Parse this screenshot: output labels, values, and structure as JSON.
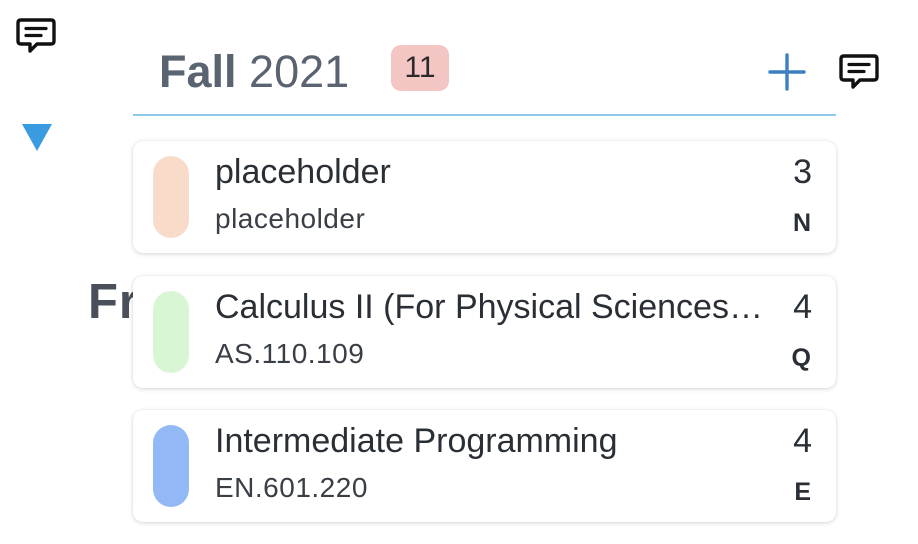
{
  "icons": {
    "left_comment": "comment-icon",
    "collapse": "triangle-down-icon",
    "add": "plus-icon",
    "header_comment": "comment-icon"
  },
  "background_heading": "Fr",
  "semester": {
    "season": "Fall",
    "year": "2021",
    "credit_total": "11"
  },
  "courses": [
    {
      "name": "placeholder",
      "code": "placeholder",
      "credits": "3",
      "area": "N",
      "color": "#f8dcc9"
    },
    {
      "name": "Calculus II (For Physical Sciences and Engineering)",
      "code": "AS.110.109",
      "credits": "4",
      "area": "Q",
      "color": "#d8f6d3"
    },
    {
      "name": "Intermediate Programming",
      "code": "EN.601.220",
      "credits": "4",
      "area": "E",
      "color": "#92b8f6"
    }
  ],
  "colors": {
    "accent": "#3d7fc1",
    "collapse_triangle": "#3b9be0",
    "divider": "#8ec9ea",
    "badge_bg": "#f3c6c4"
  }
}
